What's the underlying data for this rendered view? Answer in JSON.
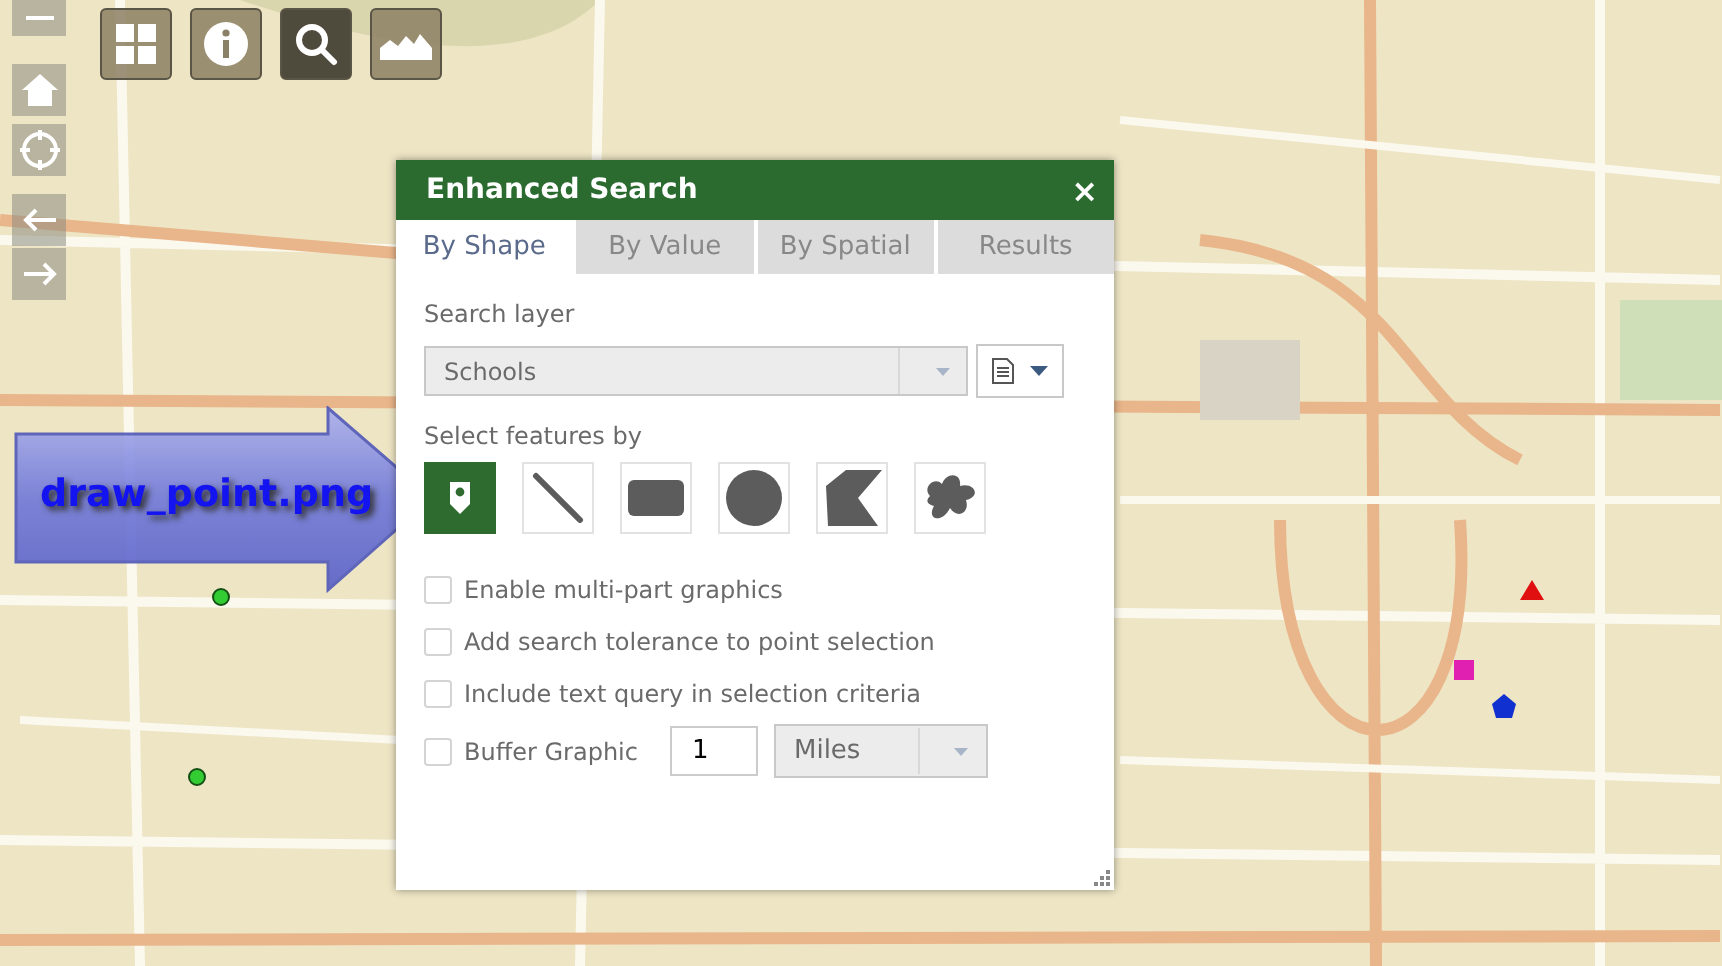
{
  "toolbar": [
    {
      "kind": "basemap",
      "selected": false
    },
    {
      "kind": "info",
      "selected": false
    },
    {
      "kind": "search",
      "selected": true
    },
    {
      "kind": "profile",
      "selected": false
    }
  ],
  "dialog": {
    "title": "Enhanced Search",
    "close": "×",
    "tabs": [
      {
        "label": "By Shape",
        "selected": true
      },
      {
        "label": "By Value",
        "selected": false
      },
      {
        "label": "By Spatial",
        "selected": false
      },
      {
        "label": "Results",
        "selected": false
      }
    ],
    "search_layer": {
      "label": "Search layer",
      "value": "Schools"
    },
    "select_label": "Select features by",
    "shapes": [
      {
        "kind": "point",
        "selected": true
      },
      {
        "kind": "line",
        "selected": false
      },
      {
        "kind": "rectangle",
        "selected": false
      },
      {
        "kind": "circle",
        "selected": false
      },
      {
        "kind": "polygon",
        "selected": false
      },
      {
        "kind": "freehand",
        "selected": false
      }
    ],
    "options": [
      {
        "label": "Enable multi-part graphics",
        "checked": false
      },
      {
        "label": "Add search tolerance to point selection",
        "checked": false
      },
      {
        "label": "Include text query in selection criteria",
        "checked": false
      }
    ],
    "buffer": {
      "label": "Buffer Graphic",
      "checked": false,
      "distance": "1",
      "unit": "Miles"
    }
  },
  "callout": {
    "text": "draw_point.png"
  }
}
